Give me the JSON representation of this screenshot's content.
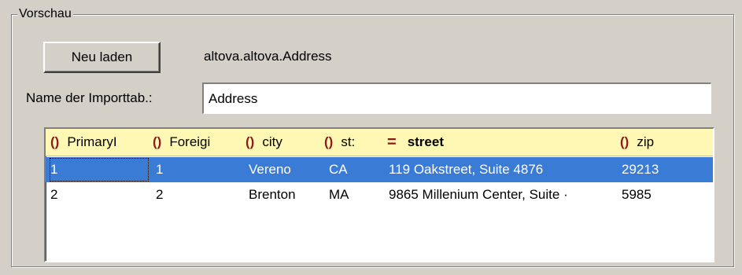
{
  "group": {
    "title": "Vorschau"
  },
  "reload_button": {
    "label": "Neu laden"
  },
  "source": {
    "name": "altova.altova.Address"
  },
  "import_name": {
    "label": "Name der Importtab.:",
    "value": "Address"
  },
  "grid": {
    "columns": [
      {
        "label": "PrimaryI",
        "icon": "element-icon"
      },
      {
        "label": "Foreigi",
        "icon": "element-icon"
      },
      {
        "label": "city",
        "icon": "element-icon"
      },
      {
        "label": "st:",
        "icon": "element-icon"
      },
      {
        "label": "street",
        "icon": "attribute-icon"
      },
      {
        "label": "zip",
        "icon": "element-icon"
      }
    ],
    "rows": [
      [
        "1",
        "1",
        "Vereno",
        "CA",
        "119 Oakstreet, Suite 4876",
        "29213"
      ],
      [
        "2",
        "2",
        "Brenton",
        "MA",
        "9865 Millenium Center, Suite ·",
        "5985"
      ]
    ],
    "selected_row": 0
  },
  "colors": {
    "selection": "#3a7bd5",
    "header_bg": "#fff8b4",
    "icon": "#8b1a1a"
  }
}
